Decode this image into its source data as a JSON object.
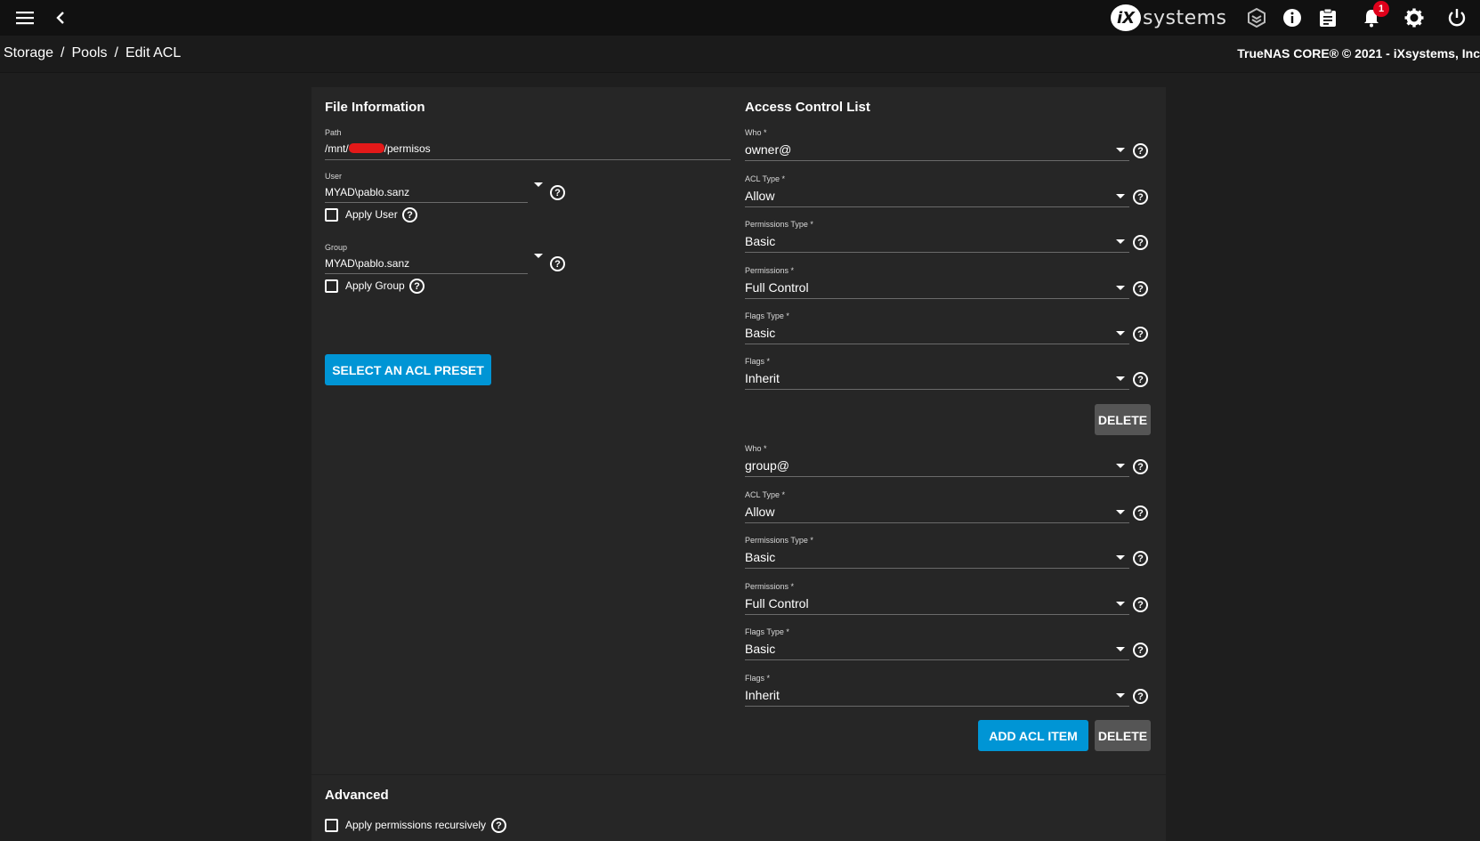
{
  "topbar": {
    "logo_word": "systems",
    "logo_mark": "iX",
    "notification_count": "1",
    "icons": [
      "menu-icon",
      "back-arrow-icon",
      "truecommand-icon",
      "info-icon",
      "clipboard-icon",
      "bell-icon",
      "gear-icon",
      "power-icon"
    ]
  },
  "breadcrumb": {
    "items": [
      "Storage",
      "Pools",
      "Edit ACL"
    ],
    "separator": "/"
  },
  "copyright": "TrueNAS CORE® © 2021 - iXsystems, Inc",
  "file_info": {
    "title": "File Information",
    "path_label": "Path",
    "path_prefix": "/mnt/",
    "path_suffix": "/permisos",
    "user_label": "User",
    "user_value": "MYAD\\pablo.sanz",
    "apply_user_label": "Apply User",
    "group_label": "Group",
    "group_value": "MYAD\\pablo.sanz",
    "apply_group_label": "Apply Group",
    "preset_button": "SELECT AN ACL PRESET"
  },
  "acl": {
    "title": "Access Control List",
    "items": [
      {
        "who_label": "Who *",
        "who": "owner@",
        "acl_type_label": "ACL Type *",
        "acl_type": "Allow",
        "perm_type_label": "Permissions Type *",
        "perm_type": "Basic",
        "perm_label": "Permissions *",
        "perm": "Full Control",
        "flags_type_label": "Flags Type *",
        "flags_type": "Basic",
        "flags_label": "Flags *",
        "flags": "Inherit",
        "delete_label": "DELETE"
      },
      {
        "who_label": "Who *",
        "who": "group@",
        "acl_type_label": "ACL Type *",
        "acl_type": "Allow",
        "perm_type_label": "Permissions Type *",
        "perm_type": "Basic",
        "perm_label": "Permissions *",
        "perm": "Full Control",
        "flags_type_label": "Flags Type *",
        "flags_type": "Basic",
        "flags_label": "Flags *",
        "flags": "Inherit",
        "delete_label": "DELETE"
      }
    ],
    "add_button": "ADD ACL ITEM"
  },
  "advanced": {
    "title": "Advanced",
    "recursive_label": "Apply permissions recursively"
  },
  "colors": {
    "primary": "#0095d5",
    "secondary": "#555555",
    "badge": "#e0001b",
    "card": "#262626",
    "topbar": "#111111"
  }
}
